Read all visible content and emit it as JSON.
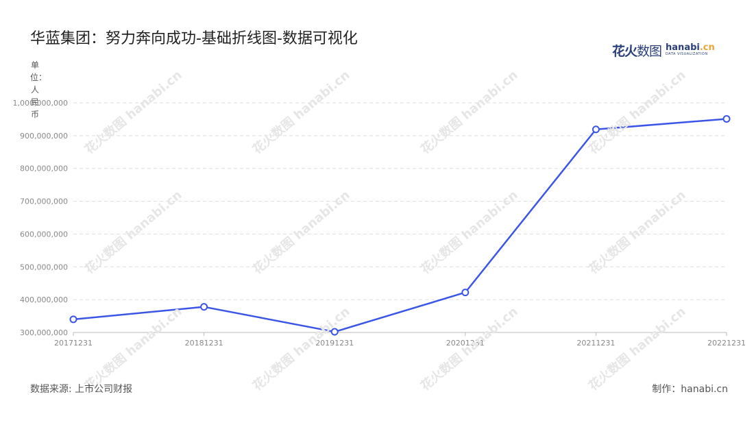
{
  "title": "华蓝集团：努力奔向成功-基础折线图-数据可视化",
  "logo": {
    "cn_bold": "花火",
    "cn_thin": "数图",
    "en_main": "hanabi",
    "en_dot": ".cn",
    "en_sub": "DATA VISUALIZATION"
  },
  "unit_label": "单位：人民币",
  "footer": {
    "source": "数据来源: 上市公司财报",
    "credit": "制作：hanabi.cn"
  },
  "watermark": "花火数图 hanabi.cn",
  "colors": {
    "line": "#3b55e6",
    "grid": "#dddddd",
    "axis": "#bbbbbb",
    "tick_text": "#888888"
  },
  "chart_data": {
    "type": "line",
    "title": "华蓝集团：努力奔向成功-基础折线图-数据可视化",
    "ylabel": "单位：人民币",
    "xlabel": "",
    "categories": [
      "20171231",
      "20181231",
      "20191231",
      "20201231",
      "20211231",
      "20221231"
    ],
    "series": [
      {
        "values": [
          340000000,
          378000000,
          302000000,
          422000000,
          919000000,
          951000000
        ]
      }
    ],
    "ylim": [
      300000000,
      1000000000
    ],
    "yticks": [
      300000000,
      400000000,
      500000000,
      600000000,
      700000000,
      800000000,
      900000000,
      1000000000
    ],
    "ytick_labels": [
      "300,000,000",
      "400,000,000",
      "500,000,000",
      "600,000,000",
      "700,000,000",
      "800,000,000",
      "900,000,000",
      "1,000,000,000"
    ],
    "grid": true,
    "legend": "none"
  }
}
